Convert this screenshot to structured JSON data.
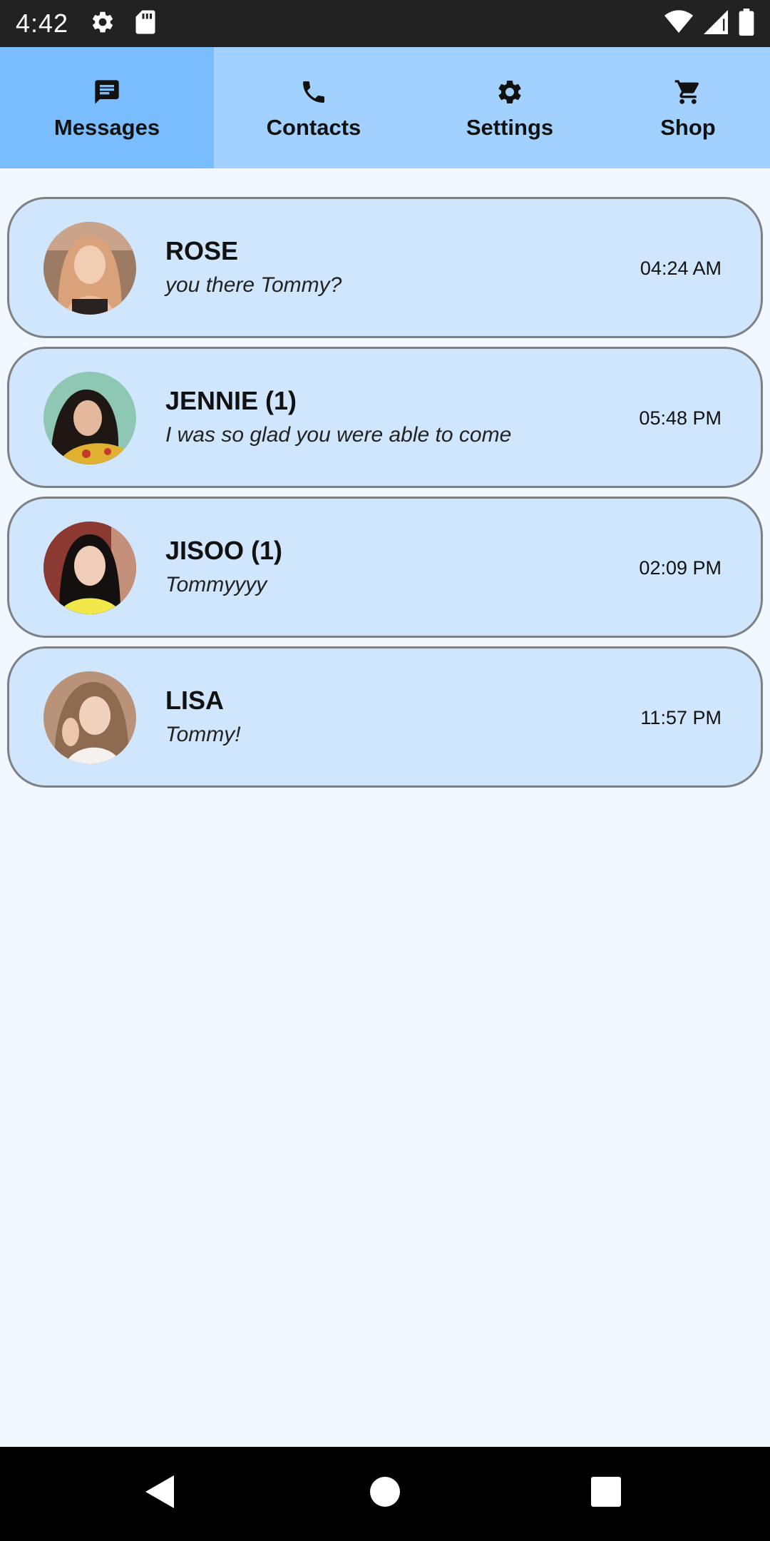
{
  "status_bar": {
    "time": "4:42",
    "left_icons": [
      "gear-icon",
      "sd-card-icon"
    ],
    "right_icons": [
      "wifi-icon",
      "signal-icon",
      "battery-icon"
    ]
  },
  "tabs": [
    {
      "label": "Messages",
      "icon": "chat-icon",
      "active": true
    },
    {
      "label": "Contacts",
      "icon": "phone-icon",
      "active": false
    },
    {
      "label": "Settings",
      "icon": "gear-icon",
      "active": false
    },
    {
      "label": "Shop",
      "icon": "cart-icon",
      "active": false
    }
  ],
  "conversations": [
    {
      "name": "ROSE",
      "preview": "you there Tommy?",
      "time": "04:24 AM"
    },
    {
      "name": "JENNIE (1)",
      "preview": "I was so glad you were able to come",
      "time": "05:48 PM"
    },
    {
      "name": "JISOO (1)",
      "preview": "Tommyyyy",
      "time": "02:09 PM"
    },
    {
      "name": "LISA",
      "preview": "Tommy!",
      "time": "11:57 PM"
    }
  ],
  "nav_bar": {
    "buttons": [
      "back-icon",
      "home-icon",
      "recents-icon"
    ]
  },
  "colors": {
    "tab_bar": "#a3d1ff",
    "tab_active": "#79bdff",
    "card_bg": "#d0e6fc",
    "page_bg": "#f1f8ff"
  }
}
